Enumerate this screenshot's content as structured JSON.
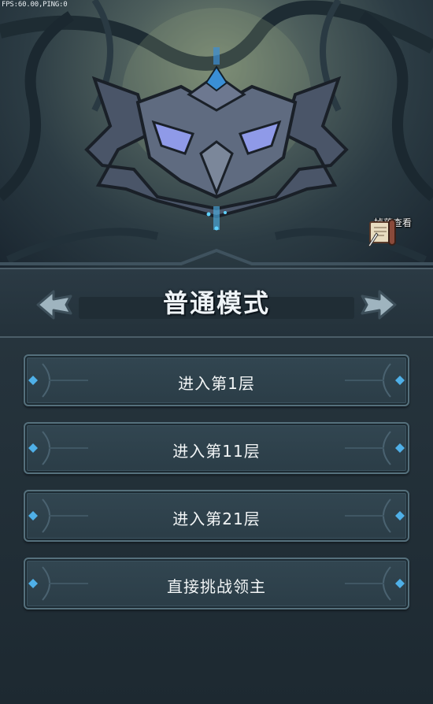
{
  "debug": {
    "fps_text": "FPS:60.00,PING:0"
  },
  "drop_view": {
    "label": "掉落查看",
    "icon": "scroll-icon"
  },
  "mode": {
    "title": "普通模式",
    "prev_icon": "arrow-left-icon",
    "next_icon": "arrow-right-icon"
  },
  "floors": [
    {
      "label": "进入第1层"
    },
    {
      "label": "进入第11层"
    },
    {
      "label": "进入第21层"
    },
    {
      "label": "直接挑战领主"
    }
  ],
  "colors": {
    "panel": "#26343d",
    "button": "#324651",
    "button_border": "#55707c",
    "text": "#f2f5f6",
    "gem": "#3a8fd6"
  }
}
